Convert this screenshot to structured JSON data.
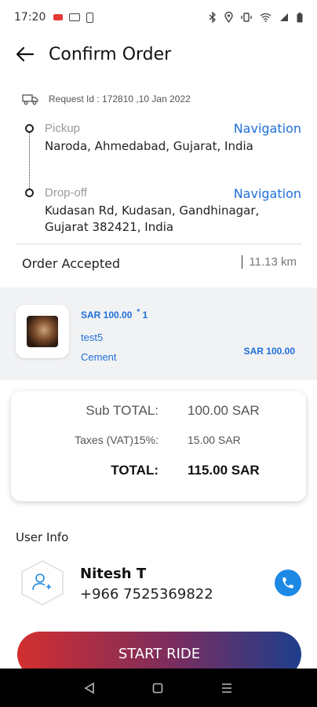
{
  "status_bar": {
    "time": "17:20"
  },
  "header": {
    "title": "Confirm Order"
  },
  "request": {
    "text": "Request Id : 172810 ,10 Jan 2022"
  },
  "pickup": {
    "label": "Pickup",
    "address": "Naroda, Ahmedabad, Gujarat, India",
    "nav_label": "Navigation"
  },
  "dropoff": {
    "label": "Drop-off",
    "address": "Kudasan Rd, Kudasan, Gandhinagar, Gujarat 382421, India",
    "nav_label": "Navigation"
  },
  "order": {
    "status": "Order Accepted",
    "distance": "11.13 km"
  },
  "product": {
    "price": "SAR  100.00",
    "star": "*",
    "quantity": "1",
    "name": "test5",
    "category": "Cement",
    "line_total": "SAR  100.00"
  },
  "totals": {
    "subtotal_label": "Sub TOTAL:",
    "subtotal_value": "100.00 SAR",
    "tax_label": "Taxes (VAT)15%:",
    "tax_value": "15.00 SAR",
    "total_label": "TOTAL:",
    "total_value": "115.00 SAR"
  },
  "user_info": {
    "title": "User Info",
    "name": "Nitesh T",
    "phone": "+966 7525369822"
  },
  "actions": {
    "start_ride": "START RIDE"
  },
  "colors": {
    "accent_blue": "#1e6fd9",
    "call_blue": "#1e88e5",
    "gradient_start": "#d32f2f",
    "gradient_end": "#1e3f8c"
  }
}
